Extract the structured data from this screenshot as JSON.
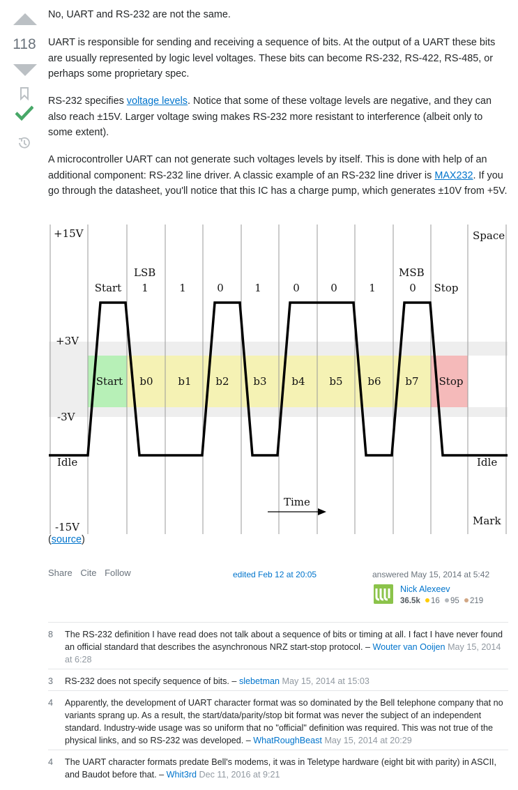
{
  "vote": {
    "count": "118"
  },
  "answer": {
    "p1": "No, UART and RS-232 are not the same.",
    "p2": "UART is responsible for sending and receiving a sequence of bits. At the output of a UART these bits are usually represented by logic level voltages. These bits can become RS-232, RS-422, RS-485, or perhaps some proprietary spec.",
    "p3_a": "RS-232 specifies ",
    "p3_link": "voltage levels",
    "p3_b": ". Notice that some of these voltage levels are negative, and they can also reach ±15V. Larger voltage swing makes RS-232 more resistant to interference (albeit only to some extent).",
    "p4_a": "A microcontroller UART can not generate such voltages levels by itself. This is done with help of an additional component: RS-232 line driver. A classic example of an RS-232 line driver is ",
    "p4_link": "MAX232",
    "p4_b": ". If you go through the datasheet, you'll notice that this IC has a charge pump, which generates ±10V from +5V.",
    "source_open": "(",
    "source_link": "source",
    "source_close": ")"
  },
  "diagram": {
    "levels": {
      "plus15": "+15V",
      "plus3": "+3V",
      "minus3": "-3V",
      "minus15": "-15V"
    },
    "idle_left": "Idle",
    "idle_right": "Idle",
    "space": "Space",
    "mark": "Mark",
    "time": "Time",
    "lsb": "LSB",
    "msb": "MSB",
    "top_labels": [
      "Start",
      "1",
      "1",
      "0",
      "1",
      "0",
      "0",
      "1",
      "0",
      "Stop"
    ],
    "band_labels": [
      "Start",
      "b0",
      "b1",
      "b2",
      "b3",
      "b4",
      "b5",
      "b6",
      "b7",
      "Stop"
    ],
    "colors": {
      "start": "#b7f0b7",
      "data": "#f5f2b4",
      "stop": "#f5baba",
      "zone": "#eeeeee"
    }
  },
  "post_menu": {
    "share": "Share",
    "cite": "Cite",
    "follow": "Follow"
  },
  "edited": "edited Feb 12 at 20:05",
  "answered": "answered May 15, 2014 at 5:42",
  "user": {
    "name": "Nick Alexeev",
    "rep": "36.5k",
    "gold": "16",
    "silver": "95",
    "bronze": "219"
  },
  "comments": [
    {
      "score": "8",
      "text": "The RS-232 definition I have read does not talk about a sequence of bits or timing at all. I fact I have never found an official standard that describes the asynchronous NRZ start-stop protocol. – ",
      "user": "Wouter van Ooijen",
      "date": "May 15, 2014 at 6:28"
    },
    {
      "score": "3",
      "text": "RS-232 does not specify sequence of bits. – ",
      "user": "slebetman",
      "date": "May 15, 2014 at 15:03"
    },
    {
      "score": "4",
      "text": "Apparently, the development of UART character format was so dominated by the Bell telephone company that no variants sprang up. As a result, the start/data/parity/stop bit format was never the subject of an independent standard. Industry-wide usage was so uniform that no \"official\" definition was required. This was not true of the physical links, and so RS-232 was developed. – ",
      "user": "WhatRoughBeast",
      "date": "May 15, 2014 at 20:29"
    },
    {
      "score": "4",
      "text": "The UART character formats predate Bell's modems, it was in Teletype hardware (eight bit with parity) in ASCII, and Baudot before that. – ",
      "user": "Whit3rd",
      "date": "Dec 11, 2016 at 9:21"
    }
  ]
}
